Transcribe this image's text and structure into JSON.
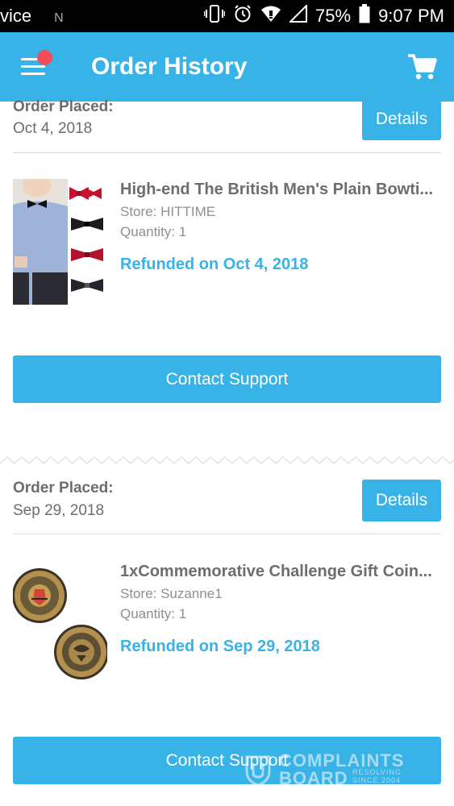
{
  "status_bar": {
    "carrier": "vice",
    "notification": "N",
    "battery": "75%",
    "time": "9:07 PM"
  },
  "app_bar": {
    "title": "Order History",
    "menu_icon": "hamburger-menu-icon",
    "cart_icon": "cart-icon",
    "colors": {
      "primary": "#37b3e8",
      "badge": "#ef4d5a"
    }
  },
  "orders": [
    {
      "placed_label": "Order Placed:",
      "date": "Oct 4, 2018",
      "details_label": "Details",
      "item": {
        "title": "High-end The British Men's Plain Bowti...",
        "store": "Store: HITTIME",
        "quantity": "Quantity: 1",
        "status": "Refunded on Oct 4, 2018"
      },
      "contact_label": "Contact Support"
    },
    {
      "placed_label": "Order Placed:",
      "date": "Sep 29, 2018",
      "details_label": "Details",
      "item": {
        "title": "1xCommemorative Challenge Gift Coin...",
        "store": "Store: Suzanne1",
        "quantity": "Quantity: 1",
        "status": "Refunded on Sep 29, 2018"
      },
      "contact_label": "Contact Support"
    }
  ],
  "watermark": {
    "line1": "COMPLAINTS",
    "line2": "BOARD",
    "sub1": "RESOLVING",
    "sub2": "SINCE 2004"
  }
}
